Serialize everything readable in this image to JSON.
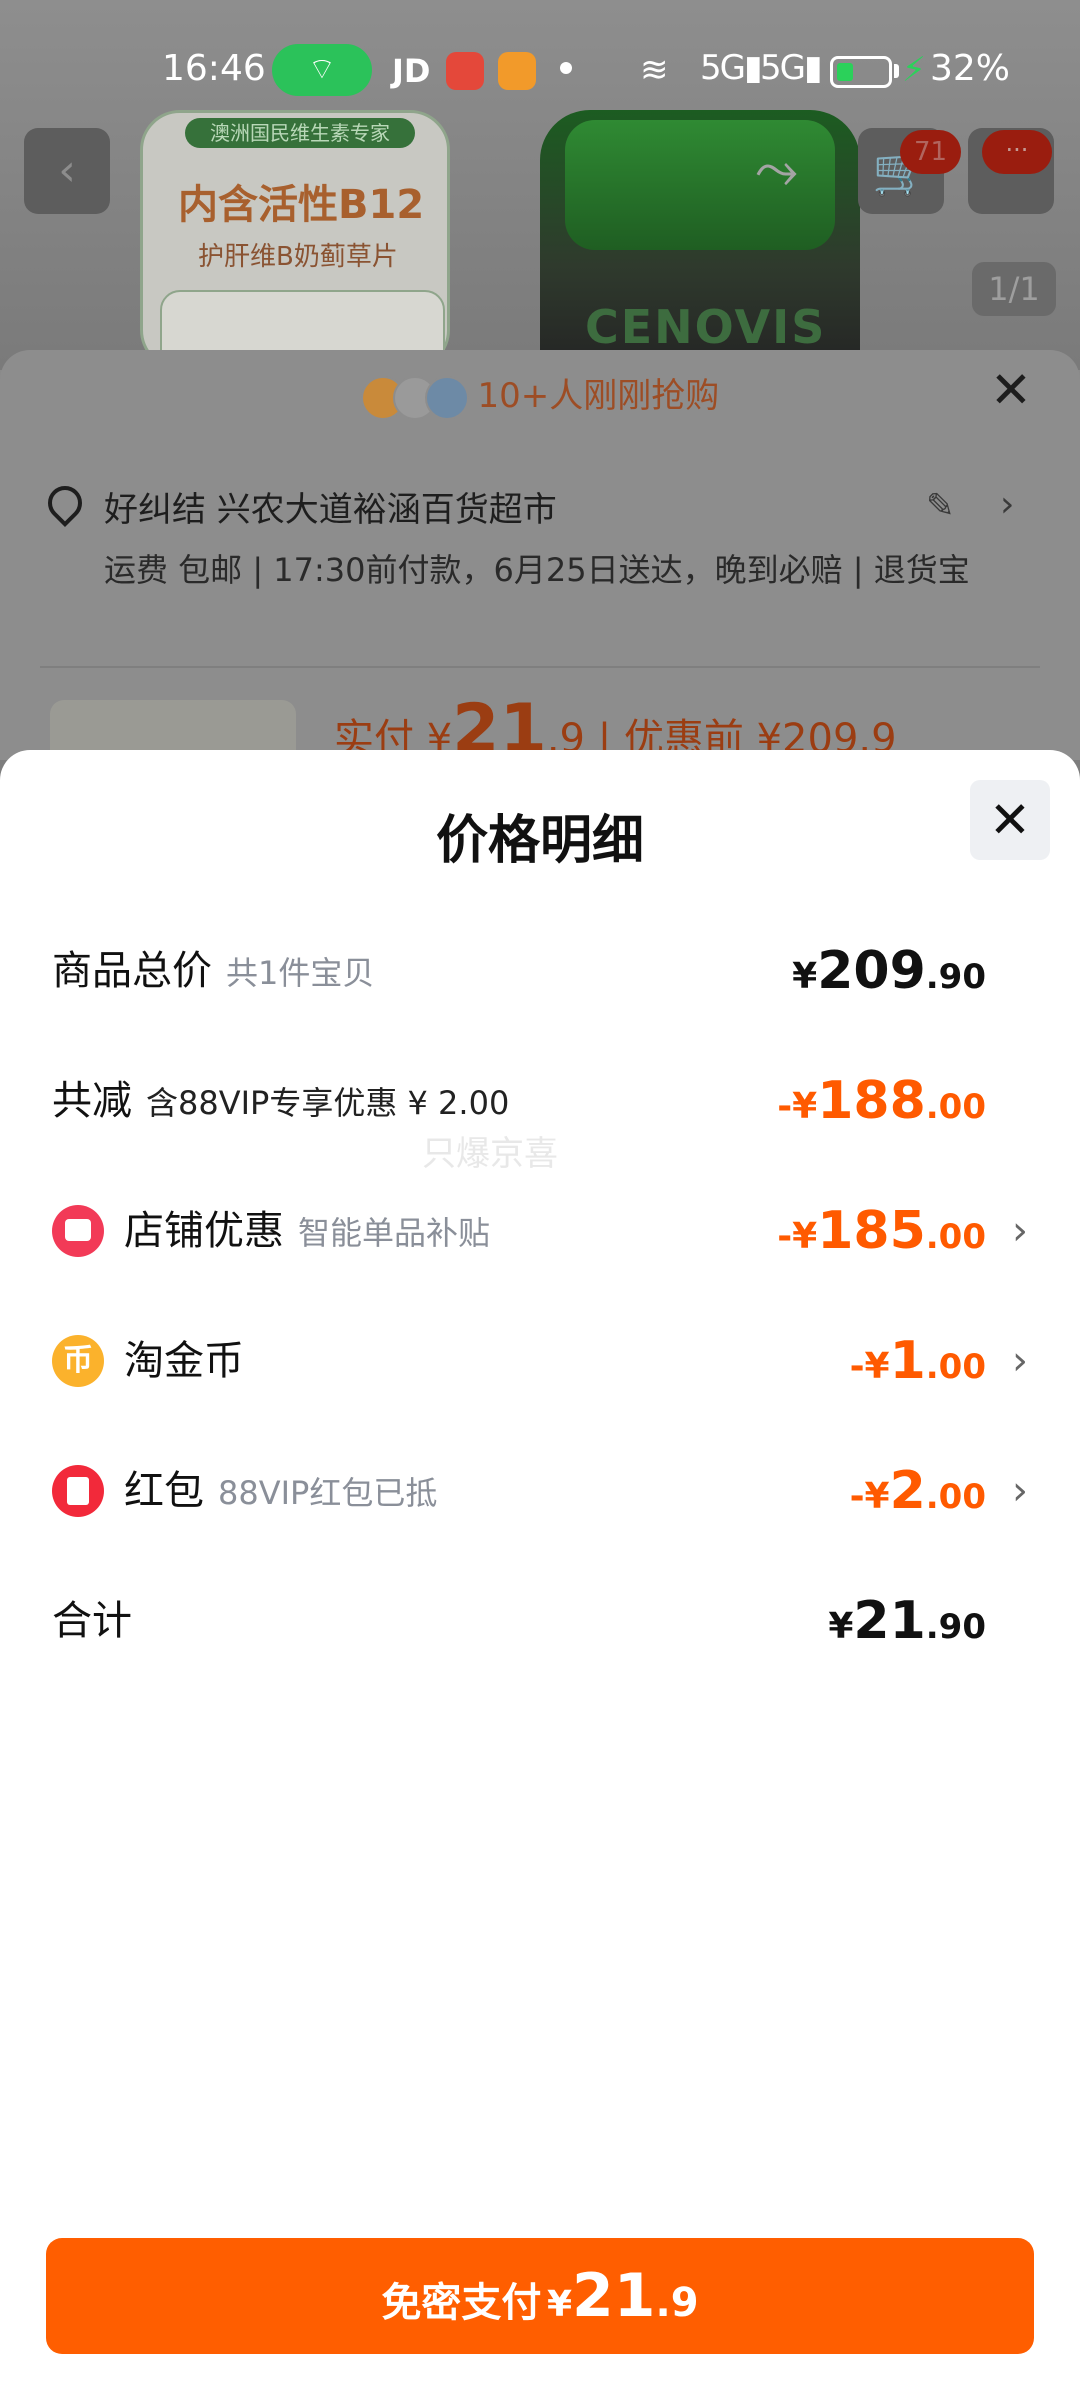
{
  "status_bar": {
    "time": "16:46",
    "carrier_app": "JD",
    "network1": "5G",
    "network2": "5G",
    "battery_pct": "32%",
    "battery_level": 0.32,
    "colors": {
      "hotspot": "#2bc25a",
      "battery_fill": "#2bd15a"
    }
  },
  "background_page": {
    "product_card": {
      "brand_strip": "澳洲国民维生素专家",
      "headline": "内含活性B12",
      "subline": "护肝维B奶蓟草片"
    },
    "bottle_label": "CENOVIS",
    "cart_badge": "71",
    "more_badge": "···",
    "image_counter": "1/1",
    "rush_text": "10+人刚刚抢购",
    "address": "好纠结 兴农大道裕涵百货超市",
    "shipping": "运费 包邮 | 17:30前付款，6月25日送达，晚到必赔 | 退货宝",
    "price_prefix": "实付",
    "price_currency": "¥",
    "price_int": "21",
    "price_dec": ".9",
    "price_before": "| 优惠前 ¥209.9"
  },
  "sheet": {
    "title": "价格明细",
    "watermark": "只爆京喜",
    "rows": [
      {
        "label": "商品总价",
        "sub": "共1件宝贝",
        "currency": "¥",
        "int": "209",
        "dec": ".90",
        "sign": "",
        "color": "dark",
        "icon": null
      },
      {
        "label": "共减",
        "sub": "含88VIP专享优惠 ¥ 2.00",
        "currency": "¥",
        "int": "188",
        "dec": ".00",
        "sign": "-",
        "color": "orange",
        "icon": null
      },
      {
        "label": "店铺优惠",
        "sub": "智能单品补贴",
        "currency": "¥",
        "int": "185",
        "dec": ".00",
        "sign": "-",
        "color": "orange",
        "icon": "shop-icon"
      },
      {
        "label": "淘金币",
        "sub": "",
        "currency": "¥",
        "int": "1",
        "dec": ".00",
        "sign": "-",
        "color": "orange",
        "icon": "coin-icon"
      },
      {
        "label": "红包",
        "sub": "88VIP红包已抵",
        "currency": "¥",
        "int": "2",
        "dec": ".00",
        "sign": "-",
        "color": "orange",
        "icon": "red-packet-icon"
      },
      {
        "label": "合计",
        "sub": "",
        "currency": "¥",
        "int": "21",
        "dec": ".90",
        "sign": "",
        "color": "dark",
        "icon": null
      }
    ],
    "coin_glyph": "币"
  },
  "pay_button": {
    "label": "免密支付",
    "currency": "¥",
    "int": "21",
    "dec": ".9"
  },
  "colors": {
    "accent": "#ff5e00",
    "discount": "#ff5a00",
    "sub_text": "#8a8f99"
  }
}
